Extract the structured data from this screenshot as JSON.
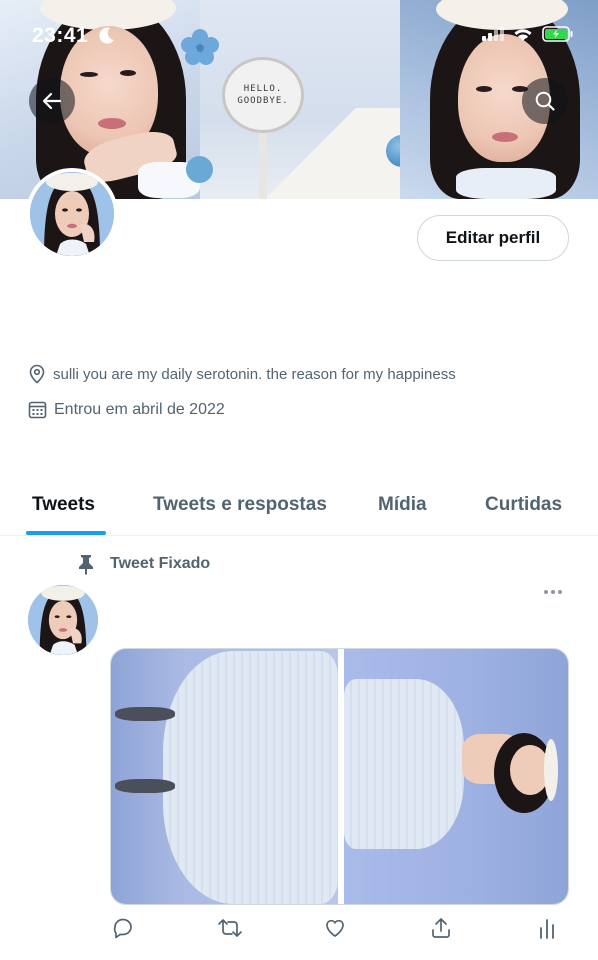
{
  "status_bar": {
    "time": "23:41"
  },
  "banner": {
    "sign_line1": "HELLO.",
    "sign_line2": "GOODBYE.",
    "back_icon": "arrow-left-icon",
    "search_icon": "search-icon"
  },
  "profile": {
    "edit_button_label": "Editar perfil",
    "location": "sulli you are my daily serotonin. the reason for my happiness",
    "joined": "Entrou em abril de 2022"
  },
  "tabs": [
    {
      "label": "Tweets",
      "active": true
    },
    {
      "label": "Tweets e respostas",
      "active": false
    },
    {
      "label": "Mídia",
      "active": false
    },
    {
      "label": "Curtidas",
      "active": false
    }
  ],
  "tweet": {
    "pinned_label": "Tweet Fixado",
    "actions": [
      "reply-icon",
      "retweet-icon",
      "like-icon",
      "share-icon",
      "analytics-icon"
    ]
  },
  "colors": {
    "accent": "#1d9bf0",
    "secondary_text": "#536471",
    "primary_text": "#0f1419",
    "border": "#cfd9de"
  }
}
